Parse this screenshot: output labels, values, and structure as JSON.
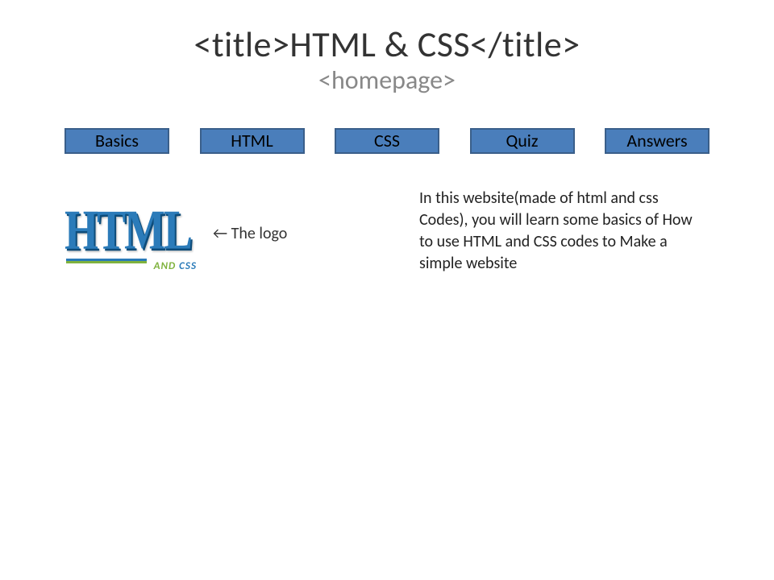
{
  "header": {
    "title": "<title>HTML & CSS</title>",
    "subtitle": "<homepage>"
  },
  "nav": {
    "items": [
      "Basics",
      "HTML",
      "CSS",
      "Quiz",
      "Answers"
    ]
  },
  "logo": {
    "big": "HTML",
    "small_and": "AND ",
    "small_css": "CSS",
    "caption": "← The logo"
  },
  "description": "In this website(made of html and css Codes), you will learn some basics of How to use HTML and CSS codes to Make a simple website"
}
